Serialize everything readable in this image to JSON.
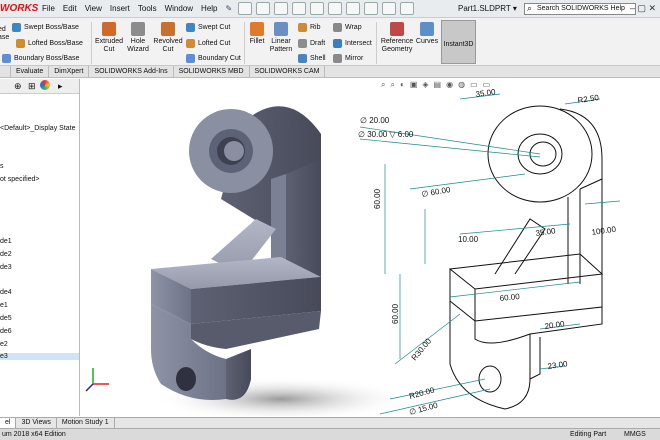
{
  "app": {
    "logo": "WORKS",
    "doc_title": "Part1.SLDPRT ▾",
    "help_placeholder": "Search SOLIDWORKS Help",
    "window_controls": "– ▢ ✕"
  },
  "menu": [
    "File",
    "Edit",
    "View",
    "Insert",
    "Tools",
    "Window",
    "Help"
  ],
  "ribbon": {
    "extrude_left": "ed\nase",
    "swept_boss": "Swept Boss/Base",
    "lofted_boss": "Lofted Boss/Base",
    "boundary_boss": "Boundary Boss/Base",
    "extruded_cut": "Extruded\nCut",
    "hole_wizard": "Hole\nWizard",
    "revolved_cut": "Revolved\nCut",
    "swept_cut": "Swept Cut",
    "lofted_cut": "Lofted Cut",
    "boundary_cut": "Boundary Cut",
    "fillet": "Fillet",
    "linear_pattern": "Linear\nPattern",
    "rib": "Rib",
    "draft": "Draft",
    "shell": "Shell",
    "wrap": "Wrap",
    "intersect": "Intersect",
    "mirror": "Mirror",
    "reference_geometry": "Reference\nGeometry",
    "curves": "Curves",
    "instant3d": "Instant3D"
  },
  "tabs": [
    "Evaluate",
    "DimXpert",
    "SOLIDWORKS Add-Ins",
    "SOLIDWORKS MBD",
    "SOLIDWORKS CAM"
  ],
  "tree": [
    "<Default>_Display State",
    "s",
    "ot specified>",
    "de1",
    "de2",
    "de3",
    "de4",
    "e1",
    "de5",
    "de6",
    "e2",
    "e3"
  ],
  "drawing": {
    "d1": "35.00",
    "d2": "R2.50",
    "d3": "∅ 20.00",
    "d4": "∅ 30.00 ▽ 6.00",
    "d5": "60.00",
    "d6": "∅ 60.00",
    "d7": "10.00",
    "d8": "35.00",
    "d9": "100.00",
    "d10": "60.00",
    "d11": "60.00",
    "d12": "R30.00",
    "d13": "20.00",
    "d14": "23.00",
    "d15": "R20.00",
    "d16": "∅ 15.00"
  },
  "bottom_tabs": [
    "el",
    "3D Views",
    "Motion Study 1"
  ],
  "status": {
    "edition": "um 2018 x64 Edition",
    "mode": "Editing Part",
    "units": "MMGS"
  }
}
